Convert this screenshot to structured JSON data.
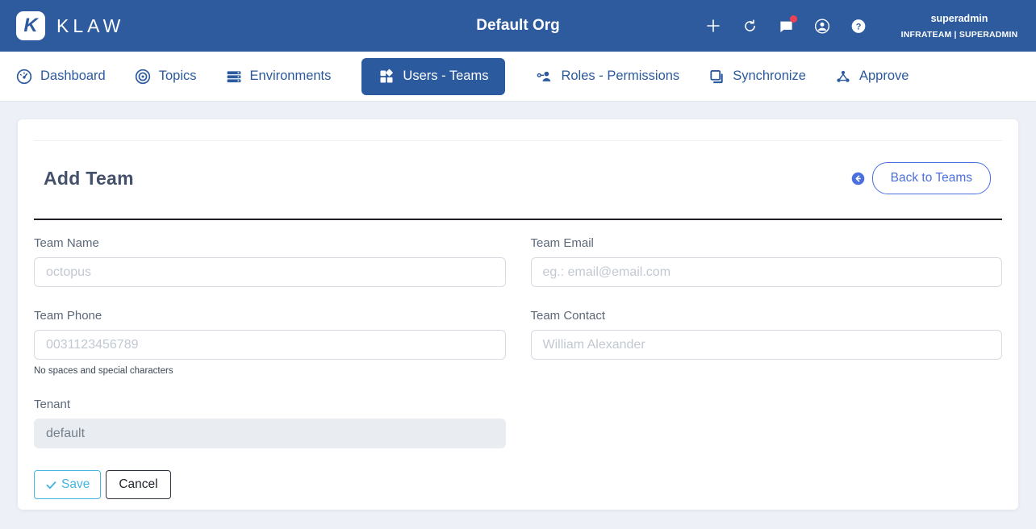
{
  "header": {
    "brand": "KLAW",
    "logo_glyph": "K",
    "org_title": "Default Org",
    "user": {
      "name": "superadmin",
      "team_role": "INFRATEAM | SUPERADMIN"
    }
  },
  "nav": {
    "tabs": [
      {
        "label": "Dashboard",
        "active": false
      },
      {
        "label": "Topics",
        "active": false
      },
      {
        "label": "Environments",
        "active": false
      },
      {
        "label": "Users - Teams",
        "active": true
      },
      {
        "label": "Roles - Permissions",
        "active": false
      },
      {
        "label": "Synchronize",
        "active": false
      },
      {
        "label": "Approve",
        "active": false
      }
    ]
  },
  "page": {
    "title": "Add Team",
    "back_button_label": "Back to Teams"
  },
  "form": {
    "team_name": {
      "label": "Team Name",
      "placeholder": "octopus"
    },
    "team_email": {
      "label": "Team Email",
      "placeholder": "eg.: email@email.com"
    },
    "team_phone": {
      "label": "Team Phone",
      "placeholder": "0031123456789",
      "hint": "No spaces and special characters"
    },
    "team_contact": {
      "label": "Team Contact",
      "placeholder": "William Alexander"
    },
    "tenant": {
      "label": "Tenant",
      "value": "default"
    },
    "save_label": "Save",
    "cancel_label": "Cancel"
  },
  "colors": {
    "header_bg": "#2d5b9e",
    "nav_accent": "#2b5a9e",
    "back_accent": "#4c6fe0",
    "save_accent": "#45b6e2",
    "notification_dot": "#ef4056",
    "page_bg": "#edf0f6"
  }
}
